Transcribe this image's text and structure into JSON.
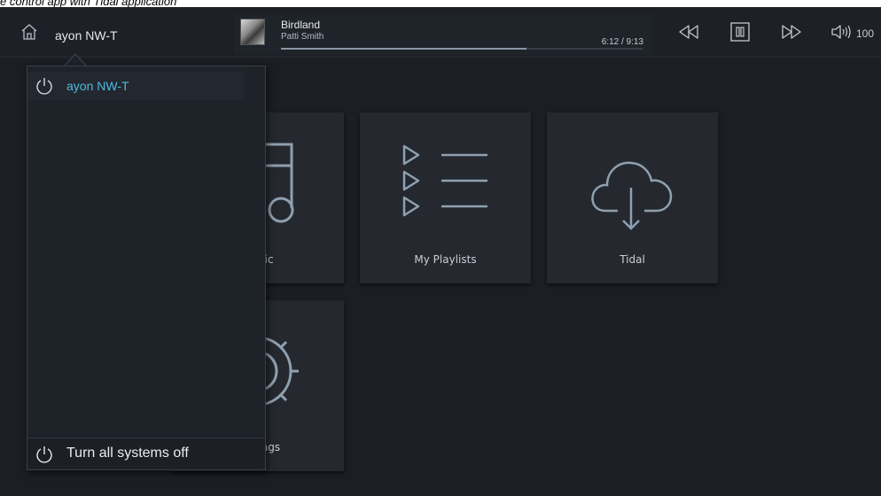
{
  "caption": "e control app with Tidal application",
  "topbar": {
    "system_name": "ayon NW-T",
    "now_playing": {
      "title": "Birdland",
      "artist": "Patti Smith",
      "time": "6:12 / 9:13",
      "progress": 0.68
    },
    "volume": "100"
  },
  "tiles": [
    {
      "id": "music",
      "label": "Music",
      "icon": "music-note-icon"
    },
    {
      "id": "playlists",
      "label": "My Playlists",
      "icon": "playlist-icon"
    },
    {
      "id": "tidal",
      "label": "Tidal",
      "icon": "cloud-download-icon"
    },
    {
      "id": "settings",
      "label": "Settings",
      "icon": "gear-icon"
    }
  ],
  "dropdown": {
    "items": [
      {
        "label": "ayon NW-T"
      }
    ],
    "footer_label": "Turn all systems off"
  },
  "colors": {
    "background": "#1b1e24",
    "accent": "#4fb8e0",
    "tile": "#25292f"
  }
}
